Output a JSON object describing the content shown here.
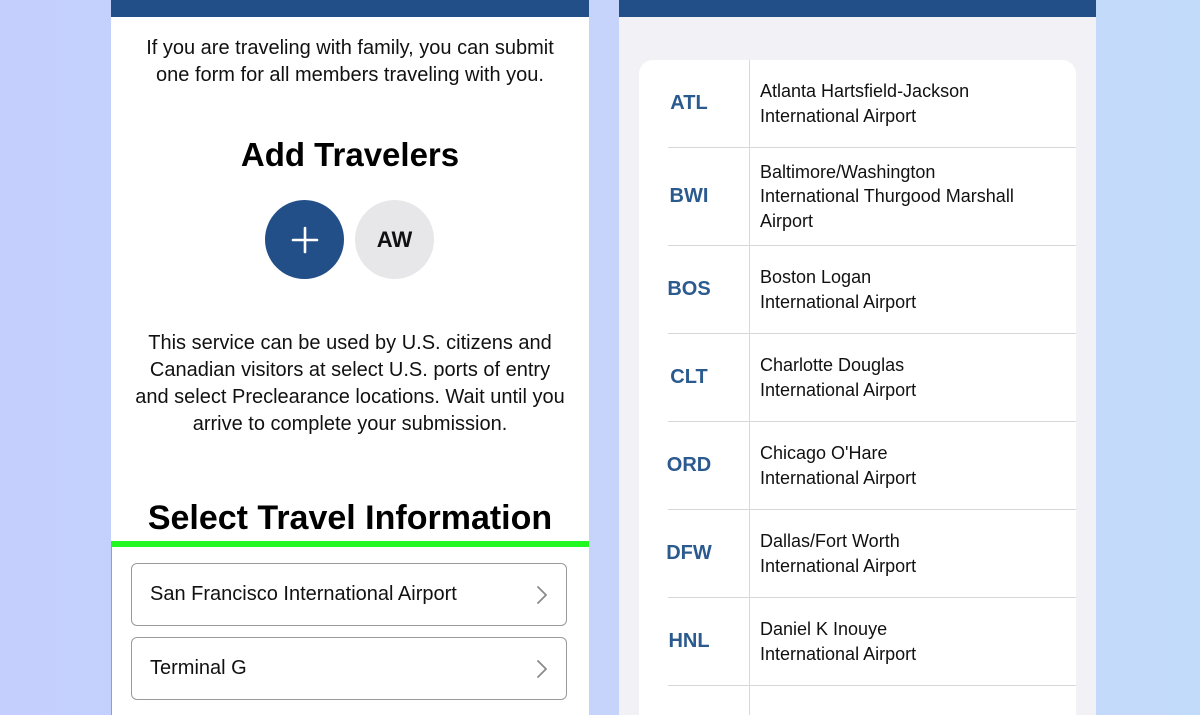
{
  "left_screen": {
    "intro_text": "If you are traveling with family, you can submit one form for all members traveling with you.",
    "add_travelers_title": "Add Travelers",
    "add_button_symbol": "+",
    "traveler_initials": "AW",
    "service_text": "This service can be used by U.S. citizens and Canadian visitors at select U.S. ports of entry and select Preclearance locations. Wait until you arrive to complete your submission.",
    "travel_info_title": "Select Travel Information",
    "airport_select_value": "San Francisco International Airport",
    "terminal_select_value": "Terminal G"
  },
  "right_screen": {
    "airports": [
      {
        "code": "ATL",
        "name_lines": [
          "Atlanta Hartsfield-Jackson",
          "International Airport"
        ]
      },
      {
        "code": "BWI",
        "name_lines": [
          "Baltimore/Washington",
          "International Thurgood Marshall",
          "Airport"
        ]
      },
      {
        "code": "BOS",
        "name_lines": [
          "Boston Logan",
          "International Airport"
        ]
      },
      {
        "code": "CLT",
        "name_lines": [
          "Charlotte Douglas",
          "International Airport"
        ]
      },
      {
        "code": "ORD",
        "name_lines": [
          "Chicago O'Hare",
          "International Airport"
        ]
      },
      {
        "code": "DFW",
        "name_lines": [
          "Dallas/Fort Worth",
          "International Airport"
        ]
      },
      {
        "code": "HNL",
        "name_lines": [
          "Daniel K Inouye",
          "International Airport"
        ]
      }
    ]
  },
  "colors": {
    "header_bar": "#224f87",
    "code_text": "#2a5a8e",
    "highlight_border": "#22f722"
  },
  "icons": {
    "add": "plus-icon",
    "chevron": "chevron-right-icon"
  }
}
